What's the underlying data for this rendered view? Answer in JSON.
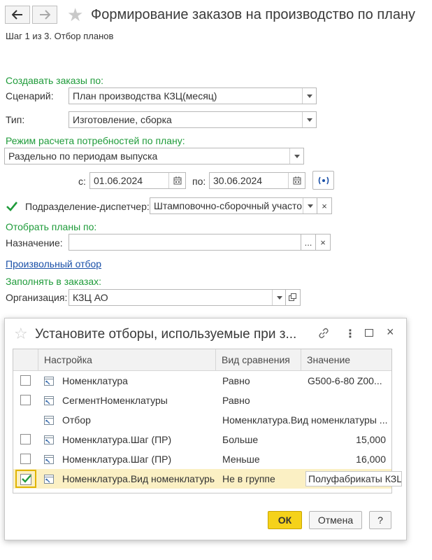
{
  "window": {
    "title": "Формирование заказов на производство по плану",
    "step": "Шаг 1 из 3. Отбор планов"
  },
  "form": {
    "create_orders_by": "Создавать заказы по:",
    "scenario_label": "Сценарий:",
    "scenario_value": "План производства КЗЦ(месяц)",
    "type_label": "Тип:",
    "type_value": "Изготовление, сборка",
    "calc_mode_label": "Режим расчета потребностей по плану:",
    "calc_mode_value": "Раздельно по периодам выпуска",
    "from_label": "с:",
    "from_value": "01.06.2024",
    "to_label": "по:",
    "to_value": "30.06.2024",
    "dispatcher_checked": true,
    "dispatcher_label": "Подразделение-диспетчер:",
    "dispatcher_value": "Штамповочно-сборочный участок",
    "select_plans_by": "Отобрать планы по:",
    "purpose_label": "Назначение:",
    "purpose_value": "",
    "custom_filter_link": "Произвольный отбор",
    "fill_in_orders": "Заполнять в заказах:",
    "org_label": "Организация:",
    "org_value": "КЗЦ АО"
  },
  "dialog": {
    "title": "Установите отборы, используемые при з...",
    "columns": [
      "Настройка",
      "Вид сравнения",
      "Значение"
    ],
    "rows": [
      {
        "setting": "Номенклатура",
        "comparison": "Равно",
        "value": "G500-6-80 Z00...",
        "checked": false,
        "has_checkbox": true,
        "selected": false
      },
      {
        "setting": "СегментНоменклатуры",
        "comparison": "Равно",
        "value": "",
        "checked": false,
        "has_checkbox": true,
        "selected": false
      },
      {
        "setting": "Отбор",
        "comparison": "Номенклатура.Вид номенклатуры ...",
        "value": "",
        "checked": false,
        "has_checkbox": false,
        "selected": false
      },
      {
        "setting": "Номенклатура.Шаг (ПР)",
        "comparison": "Больше",
        "value": "15,000",
        "checked": false,
        "has_checkbox": true,
        "selected": false
      },
      {
        "setting": "Номенклатура.Шаг (ПР)",
        "comparison": "Меньше",
        "value": "16,000",
        "checked": false,
        "has_checkbox": true,
        "selected": false
      },
      {
        "setting": "Номенклатура.Вид номенклатуры",
        "comparison": "Не в группе",
        "value": "Полуфабрикаты КЗЦ",
        "checked": true,
        "has_checkbox": true,
        "selected": true
      }
    ],
    "ok_label": "ОК",
    "cancel_label": "Отмена",
    "help_label": "?"
  },
  "colors": {
    "accent_green": "#1f9b3a",
    "link_blue": "#1a50a8",
    "ok_yellow": "#f5d21a",
    "selected_row": "#fbf0c4"
  }
}
